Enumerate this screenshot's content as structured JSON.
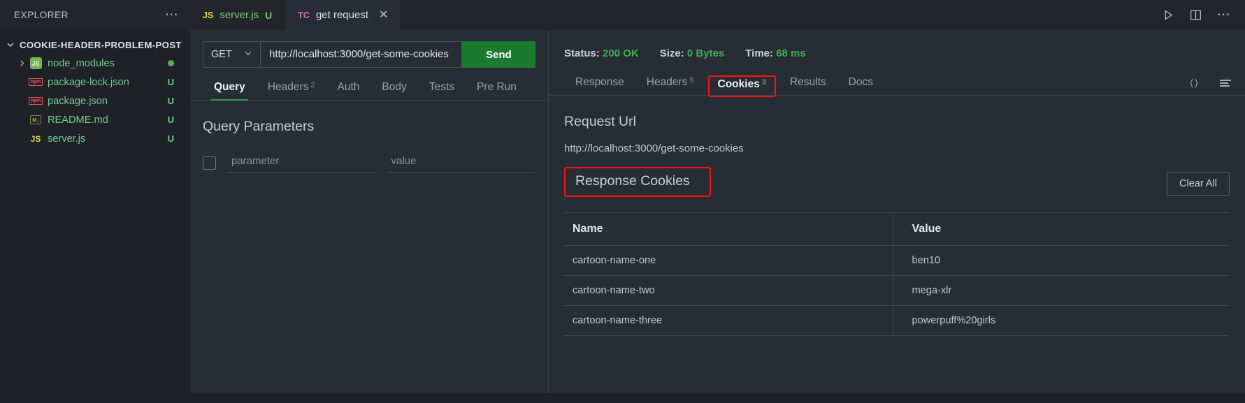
{
  "explorer": {
    "title": "EXPLORER",
    "more_label": "⋯",
    "root": "COOKIE-HEADER-PROBLEM-POST",
    "items": [
      {
        "label": "node_modules",
        "icon": "node-folder-icon",
        "badge": "",
        "dot": true,
        "expandable": true
      },
      {
        "label": "package-lock.json",
        "icon": "npm-icon",
        "badge": "U",
        "dot": false,
        "expandable": false
      },
      {
        "label": "package.json",
        "icon": "npm-icon",
        "badge": "U",
        "dot": false,
        "expandable": false
      },
      {
        "label": "README.md",
        "icon": "markdown-icon",
        "badge": "U",
        "dot": false,
        "expandable": false
      },
      {
        "label": "server.js",
        "icon": "js-icon",
        "badge": "U",
        "dot": false,
        "expandable": false
      }
    ]
  },
  "editor_tabs": [
    {
      "icon": "JS",
      "label": "server.js",
      "dirty": "U",
      "active": false
    },
    {
      "icon": "TC",
      "label": "get request",
      "dirty": "",
      "active": true,
      "close": "✕"
    }
  ],
  "window_actions": [
    {
      "name": "run-icon"
    },
    {
      "name": "split-editor-icon"
    },
    {
      "name": "more-actions-icon"
    }
  ],
  "request": {
    "method": "GET",
    "url": "http://localhost:3000/get-some-cookies",
    "send_label": "Send",
    "tabs": [
      {
        "label": "Query",
        "count": "",
        "active": true
      },
      {
        "label": "Headers",
        "count": "2",
        "active": false
      },
      {
        "label": "Auth",
        "count": "",
        "active": false
      },
      {
        "label": "Body",
        "count": "",
        "active": false
      },
      {
        "label": "Tests",
        "count": "",
        "active": false
      },
      {
        "label": "Pre Run",
        "count": "",
        "active": false
      }
    ],
    "query_section_title": "Query Parameters",
    "param_placeholder": "parameter",
    "value_placeholder": "value"
  },
  "response": {
    "status_label": "Status:",
    "status_value": "200 OK",
    "size_label": "Size:",
    "size_value": "0 Bytes",
    "time_label": "Time:",
    "time_value": "68 ms",
    "tabs": [
      {
        "label": "Response",
        "count": "",
        "active": false,
        "boxed": false
      },
      {
        "label": "Headers",
        "count": "9",
        "active": false,
        "boxed": false
      },
      {
        "label": "Cookies",
        "count": "3",
        "active": true,
        "boxed": true
      },
      {
        "label": "Results",
        "count": "",
        "active": false,
        "boxed": false
      },
      {
        "label": "Docs",
        "count": "",
        "active": false,
        "boxed": false
      }
    ],
    "strip_icons": [
      {
        "name": "json-format-icon",
        "glyph": "{}"
      },
      {
        "name": "raw-lines-icon",
        "glyph": "lines"
      }
    ],
    "request_url_title": "Request Url",
    "request_url_value": "http://localhost:3000/get-some-cookies",
    "cookies_title": "Response Cookies",
    "clear_all_label": "Clear All",
    "cookies_table": {
      "columns": [
        "Name",
        "Value"
      ],
      "rows": [
        [
          "cartoon-name-one",
          "ben10"
        ],
        [
          "cartoon-name-two",
          "mega-xlr"
        ],
        [
          "cartoon-name-three",
          "powerpuff%20girls"
        ]
      ]
    }
  },
  "colors": {
    "accent_green": "#2e9e3f",
    "highlight_red": "#ff1010",
    "status_green": "#3fae4f",
    "file_green": "#73c991"
  }
}
